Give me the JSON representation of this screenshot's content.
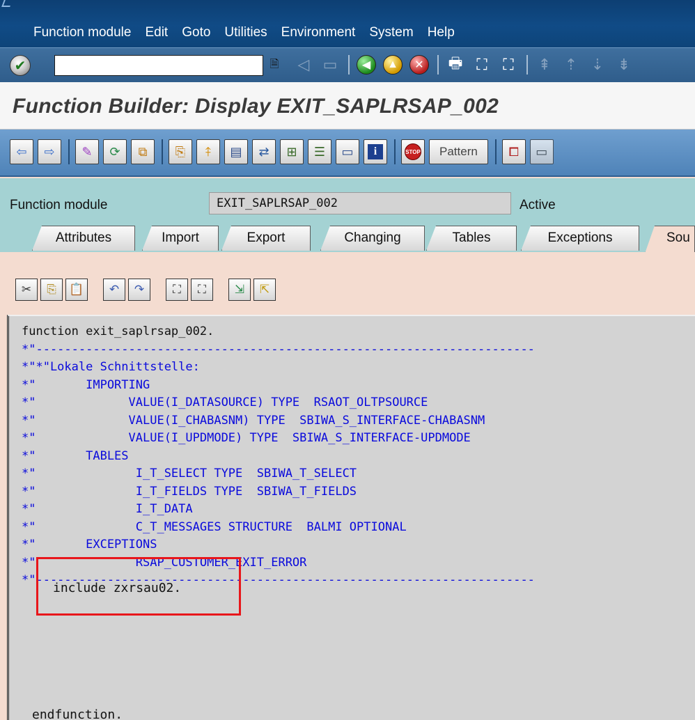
{
  "menu": {
    "items": [
      {
        "label": "Function module",
        "hot": "F"
      },
      {
        "label": "Edit",
        "hot": "E"
      },
      {
        "label": "Goto",
        "hot": "G"
      },
      {
        "label": "Utilities",
        "hot": "U"
      },
      {
        "label": "Environment",
        "hot": "v"
      },
      {
        "label": "System",
        "hot": "y"
      },
      {
        "label": "Help",
        "hot": "H"
      }
    ]
  },
  "system_toolbar": {
    "command_value": "",
    "icons": [
      "enter-icon",
      "back-icon",
      "save-icon",
      "back-green-icon",
      "exit-icon",
      "cancel-icon",
      "print-icon",
      "find-icon",
      "find-next-icon",
      "first-page-icon",
      "previous-page-icon",
      "next-page-icon",
      "last-page-icon"
    ]
  },
  "title": "Function Builder: Display EXIT_SAPLRSAP_002",
  "app_toolbar": {
    "pattern_label": "Pattern"
  },
  "header": {
    "label": "Function module",
    "value": "EXIT_SAPLRSAP_002",
    "status": "Active"
  },
  "tabs": [
    {
      "label": "Attributes"
    },
    {
      "label": "Import"
    },
    {
      "label": "Export"
    },
    {
      "label": "Changing"
    },
    {
      "label": "Tables"
    },
    {
      "label": "Exceptions"
    },
    {
      "label": "Sou"
    }
  ],
  "code": {
    "first_line": "function exit_saplrsap_002.",
    "comment_lines": [
      "*\"----------------------------------------------------------------------",
      "*\"*\"Lokale Schnittstelle:",
      "*\"       IMPORTING",
      "*\"             VALUE(I_DATASOURCE) TYPE  RSAOT_OLTPSOURCE",
      "*\"             VALUE(I_CHABASNM) TYPE  SBIWA_S_INTERFACE-CHABASNM",
      "*\"             VALUE(I_UPDMODE) TYPE  SBIWA_S_INTERFACE-UPDMODE",
      "*\"       TABLES",
      "*\"              I_T_SELECT TYPE  SBIWA_T_SELECT",
      "*\"              I_T_FIELDS TYPE  SBIWA_T_FIELDS",
      "*\"              I_T_DATA",
      "*\"              C_T_MESSAGES STRUCTURE  BALMI OPTIONAL",
      "*\"       EXCEPTIONS",
      "*\"              RSAP_CUSTOMER_EXIT_ERROR",
      "*\"----------------------------------------------------------------------"
    ],
    "include_line": "include zxrsau02.",
    "end_line": "endfunction."
  }
}
